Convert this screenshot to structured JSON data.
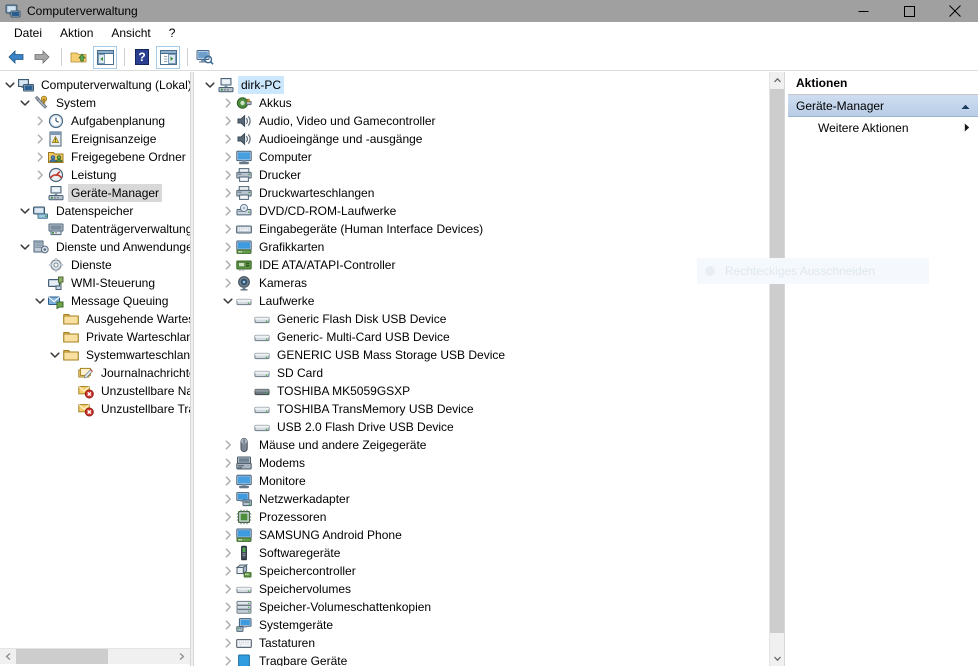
{
  "window": {
    "title": "Computerverwaltung",
    "icon": "computer-management-icon",
    "controls": {
      "minimize": "minimize-icon",
      "maximize": "maximize-icon",
      "close": "close-icon"
    }
  },
  "menubar": {
    "items": [
      {
        "label": "Datei"
      },
      {
        "label": "Aktion"
      },
      {
        "label": "Ansicht"
      },
      {
        "label": "?"
      }
    ]
  },
  "toolbar": {
    "buttons": [
      {
        "name": "back-button",
        "icon": "arrow-left-icon",
        "framed": false
      },
      {
        "name": "forward-button",
        "icon": "arrow-right-icon",
        "framed": false
      },
      {
        "name": "separator-1",
        "icon": "separator",
        "framed": false
      },
      {
        "name": "up-one-level-button",
        "icon": "folder-up-icon",
        "framed": false
      },
      {
        "name": "show-hide-console-tree-button",
        "icon": "console-tree-icon",
        "framed": true
      },
      {
        "name": "separator-2",
        "icon": "separator",
        "framed": false
      },
      {
        "name": "help-button",
        "icon": "help-question-icon",
        "framed": false
      },
      {
        "name": "show-hide-action-pane-button",
        "icon": "action-pane-icon",
        "framed": true
      },
      {
        "name": "separator-3",
        "icon": "separator",
        "framed": false
      },
      {
        "name": "scan-hardware-changes-button",
        "icon": "monitor-search-icon",
        "framed": false
      }
    ]
  },
  "sidebar": {
    "items": [
      {
        "label": "Computerverwaltung (Lokal)",
        "indent": 0,
        "twist": "expanded",
        "icon": "computer-management-icon",
        "selected": "none"
      },
      {
        "label": "System",
        "indent": 1,
        "twist": "expanded",
        "icon": "system-tools-icon",
        "selected": "none"
      },
      {
        "label": "Aufgabenplanung",
        "indent": 2,
        "twist": "collapsed",
        "icon": "task-scheduler-clock-icon",
        "selected": "none"
      },
      {
        "label": "Ereignisanzeige",
        "indent": 2,
        "twist": "collapsed",
        "icon": "event-viewer-icon",
        "selected": "none"
      },
      {
        "label": "Freigegebene Ordner",
        "indent": 2,
        "twist": "collapsed",
        "icon": "shared-folders-icon",
        "selected": "none"
      },
      {
        "label": "Leistung",
        "indent": 2,
        "twist": "collapsed",
        "icon": "performance-gauge-icon",
        "selected": "none"
      },
      {
        "label": "Geräte-Manager",
        "indent": 2,
        "twist": "none",
        "icon": "device-manager-icon",
        "selected": "inactive"
      },
      {
        "label": "Datenspeicher",
        "indent": 1,
        "twist": "expanded",
        "icon": "storage-icon",
        "selected": "none"
      },
      {
        "label": "Datenträgerverwaltung",
        "indent": 2,
        "twist": "none",
        "icon": "disk-management-icon",
        "selected": "none"
      },
      {
        "label": "Dienste und Anwendungen",
        "indent": 1,
        "twist": "expanded",
        "icon": "services-apps-icon",
        "selected": "none"
      },
      {
        "label": "Dienste",
        "indent": 2,
        "twist": "none",
        "icon": "services-gear-icon",
        "selected": "none"
      },
      {
        "label": "WMI-Steuerung",
        "indent": 2,
        "twist": "none",
        "icon": "wmi-control-icon",
        "selected": "none"
      },
      {
        "label": "Message Queuing",
        "indent": 2,
        "twist": "expanded",
        "icon": "message-queuing-icon",
        "selected": "none"
      },
      {
        "label": "Ausgehende Warteschlangen",
        "indent": 3,
        "twist": "none",
        "icon": "folder-icon",
        "selected": "none"
      },
      {
        "label": "Private Warteschlangen",
        "indent": 3,
        "twist": "none",
        "icon": "folder-icon",
        "selected": "none"
      },
      {
        "label": "Systemwarteschlangen",
        "indent": 3,
        "twist": "expanded",
        "icon": "folder-icon",
        "selected": "none"
      },
      {
        "label": "Journalnachrichten",
        "indent": 4,
        "twist": "none",
        "icon": "journal-messages-icon",
        "selected": "none"
      },
      {
        "label": "Unzustellbare Nachrichten",
        "indent": 4,
        "twist": "none",
        "icon": "dead-letter-icon",
        "selected": "none"
      },
      {
        "label": "Unzustellbare Transaktionsnachrichten",
        "indent": 4,
        "twist": "none",
        "icon": "dead-letter-icon",
        "selected": "none"
      }
    ]
  },
  "device_tree": {
    "items": [
      {
        "label": "dirk-PC",
        "indent": 0,
        "twist": "expanded",
        "icon": "computer-root-icon",
        "selected": "active"
      },
      {
        "label": "Akkus",
        "indent": 1,
        "twist": "collapsed",
        "icon": "battery-icon",
        "selected": "none"
      },
      {
        "label": "Audio, Video und Gamecontroller",
        "indent": 1,
        "twist": "collapsed",
        "icon": "speaker-icon",
        "selected": "none"
      },
      {
        "label": "Audioeingänge und -ausgänge",
        "indent": 1,
        "twist": "collapsed",
        "icon": "speaker-icon",
        "selected": "none"
      },
      {
        "label": "Computer",
        "indent": 1,
        "twist": "collapsed",
        "icon": "monitor-icon",
        "selected": "none"
      },
      {
        "label": "Drucker",
        "indent": 1,
        "twist": "collapsed",
        "icon": "printer-icon",
        "selected": "none"
      },
      {
        "label": "Druckwarteschlangen",
        "indent": 1,
        "twist": "collapsed",
        "icon": "printer-icon",
        "selected": "none"
      },
      {
        "label": "DVD/CD-ROM-Laufwerke",
        "indent": 1,
        "twist": "collapsed",
        "icon": "optical-drive-icon",
        "selected": "none"
      },
      {
        "label": "Eingabegeräte (Human Interface Devices)",
        "indent": 1,
        "twist": "collapsed",
        "icon": "hid-icon",
        "selected": "none"
      },
      {
        "label": "Grafikkarten",
        "indent": 1,
        "twist": "collapsed",
        "icon": "display-adapter-icon",
        "selected": "none"
      },
      {
        "label": "IDE ATA/ATAPI-Controller",
        "indent": 1,
        "twist": "collapsed",
        "icon": "ide-controller-icon",
        "selected": "none"
      },
      {
        "label": "Kameras",
        "indent": 1,
        "twist": "collapsed",
        "icon": "camera-icon",
        "selected": "none"
      },
      {
        "label": "Laufwerke",
        "indent": 1,
        "twist": "expanded",
        "icon": "disk-drive-icon",
        "selected": "none"
      },
      {
        "label": "Generic Flash Disk USB Device",
        "indent": 2,
        "twist": "none",
        "icon": "disk-drive-icon",
        "selected": "none"
      },
      {
        "label": "Generic- Multi-Card USB Device",
        "indent": 2,
        "twist": "none",
        "icon": "disk-drive-icon",
        "selected": "none"
      },
      {
        "label": "GENERIC USB Mass Storage USB Device",
        "indent": 2,
        "twist": "none",
        "icon": "disk-drive-icon",
        "selected": "none"
      },
      {
        "label": "SD Card",
        "indent": 2,
        "twist": "none",
        "icon": "disk-drive-icon",
        "selected": "none"
      },
      {
        "label": "TOSHIBA MK5059GSXP",
        "indent": 2,
        "twist": "none",
        "icon": "disk-drive-dark-icon",
        "selected": "none"
      },
      {
        "label": "TOSHIBA TransMemory USB Device",
        "indent": 2,
        "twist": "none",
        "icon": "disk-drive-icon",
        "selected": "none"
      },
      {
        "label": "USB 2.0 Flash Drive USB Device",
        "indent": 2,
        "twist": "none",
        "icon": "disk-drive-icon",
        "selected": "none"
      },
      {
        "label": "Mäuse und andere Zeigegeräte",
        "indent": 1,
        "twist": "collapsed",
        "icon": "mouse-icon",
        "selected": "none"
      },
      {
        "label": "Modems",
        "indent": 1,
        "twist": "collapsed",
        "icon": "modem-icon",
        "selected": "none"
      },
      {
        "label": "Monitore",
        "indent": 1,
        "twist": "collapsed",
        "icon": "monitor-icon",
        "selected": "none"
      },
      {
        "label": "Netzwerkadapter",
        "indent": 1,
        "twist": "collapsed",
        "icon": "network-adapter-icon",
        "selected": "none"
      },
      {
        "label": "Prozessoren",
        "indent": 1,
        "twist": "collapsed",
        "icon": "processor-icon",
        "selected": "none"
      },
      {
        "label": "SAMSUNG Android Phone",
        "indent": 1,
        "twist": "collapsed",
        "icon": "android-phone-icon",
        "selected": "none"
      },
      {
        "label": "Softwaregeräte",
        "indent": 1,
        "twist": "collapsed",
        "icon": "software-device-icon",
        "selected": "none"
      },
      {
        "label": "Speichercontroller",
        "indent": 1,
        "twist": "collapsed",
        "icon": "storage-controller-icon",
        "selected": "none"
      },
      {
        "label": "Speichervolumes",
        "indent": 1,
        "twist": "collapsed",
        "icon": "disk-drive-icon",
        "selected": "none"
      },
      {
        "label": "Speicher-Volumeschattenkopien",
        "indent": 1,
        "twist": "collapsed",
        "icon": "shadow-copy-icon",
        "selected": "none"
      },
      {
        "label": "Systemgeräte",
        "indent": 1,
        "twist": "collapsed",
        "icon": "system-device-icon",
        "selected": "none"
      },
      {
        "label": "Tastaturen",
        "indent": 1,
        "twist": "collapsed",
        "icon": "keyboard-icon",
        "selected": "none"
      },
      {
        "label": "Tragbare Geräte",
        "indent": 1,
        "twist": "collapsed",
        "icon": "portable-device-icon",
        "selected": "none"
      }
    ]
  },
  "actions": {
    "header": "Aktionen",
    "group": {
      "label": "Geräte-Manager",
      "collapse_icon": "chevron-up-icon"
    },
    "items": [
      {
        "label": "Weitere Aktionen",
        "submenu_icon": "chevron-right-icon"
      }
    ]
  },
  "overlay": {
    "label": "Rechteckiges Ausschneiden"
  },
  "colors": {
    "titlebar": "#a0a0a0",
    "selection_active": "#cce8ff",
    "selection_inactive": "#d8d8d8",
    "action_group": "#bcd0e8",
    "scrollbar_track": "#f0f0f0",
    "scrollbar_thumb": "#cdcdcd",
    "panel_border": "#d6d6d6"
  }
}
